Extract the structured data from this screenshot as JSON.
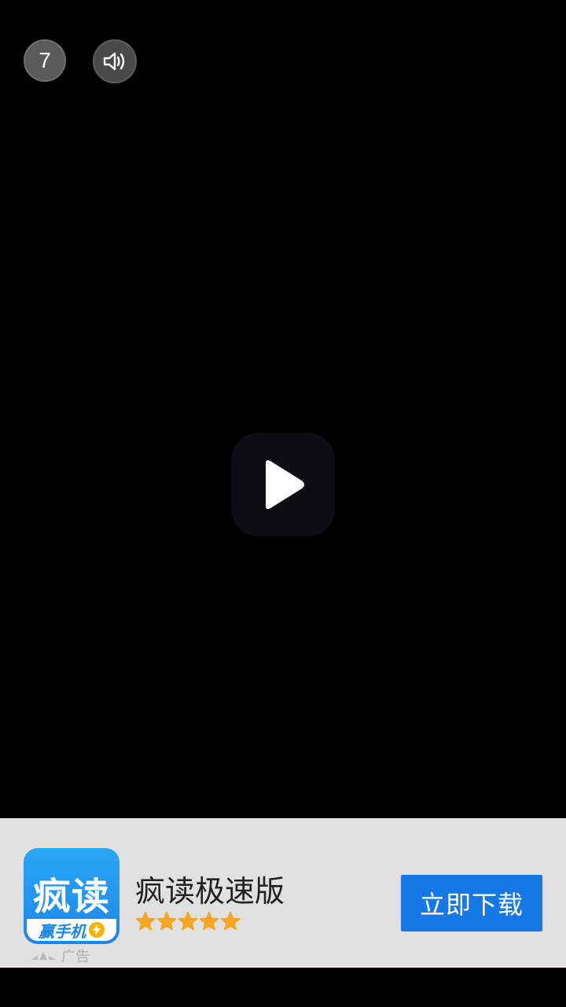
{
  "video": {
    "countdown": "7",
    "volume_icon": "speaker-volume-icon",
    "play_icon": "play-icon"
  },
  "ad": {
    "app_icon_text": "疯读",
    "app_icon_subtext": "赢手机",
    "app_name": "疯读极速版",
    "rating": 5,
    "star_color": "#f5a623",
    "ad_label": "广告",
    "download_label": "立即下载",
    "button_color": "#1677e6"
  }
}
